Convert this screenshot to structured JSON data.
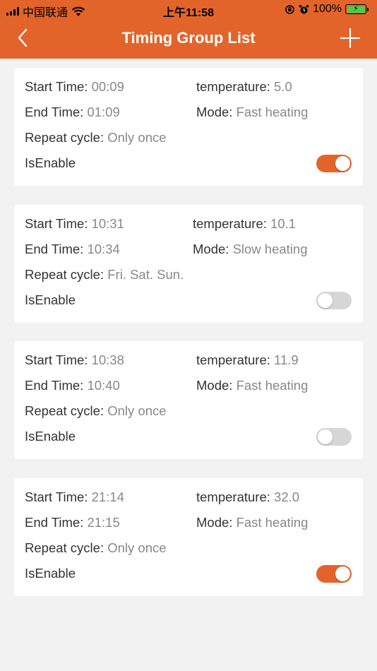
{
  "status_bar": {
    "carrier": "中国联通",
    "time": "上午11:58",
    "battery": "100%"
  },
  "nav": {
    "title": "Timing Group List",
    "back_icon": "chevron-left-icon",
    "add_icon": "plus-icon"
  },
  "labels": {
    "start_time": "Start Time:",
    "end_time": "End Time:",
    "temperature": "temperature:",
    "mode": "Mode:",
    "repeat_cycle": "Repeat cycle:",
    "is_enable": "IsEnable"
  },
  "colors": {
    "accent": "#e3642b",
    "toggle_off": "#d6d6d6",
    "background": "#f2f2f2"
  },
  "groups": [
    {
      "start_time": "00:09",
      "end_time": "01:09",
      "temperature": "5.0",
      "mode": "Fast heating",
      "repeat_cycle": "Only once",
      "enabled": true
    },
    {
      "start_time": "10:31",
      "end_time": "10:34",
      "temperature": "10.1",
      "mode": "Slow heating",
      "repeat_cycle": "Fri. Sat. Sun.",
      "enabled": false
    },
    {
      "start_time": "10:38",
      "end_time": "10:40",
      "temperature": "11.9",
      "mode": "Fast heating",
      "repeat_cycle": "Only once",
      "enabled": false
    },
    {
      "start_time": "21:14",
      "end_time": "21:15",
      "temperature": "32.0",
      "mode": "Fast heating",
      "repeat_cycle": "Only once",
      "enabled": true
    }
  ]
}
